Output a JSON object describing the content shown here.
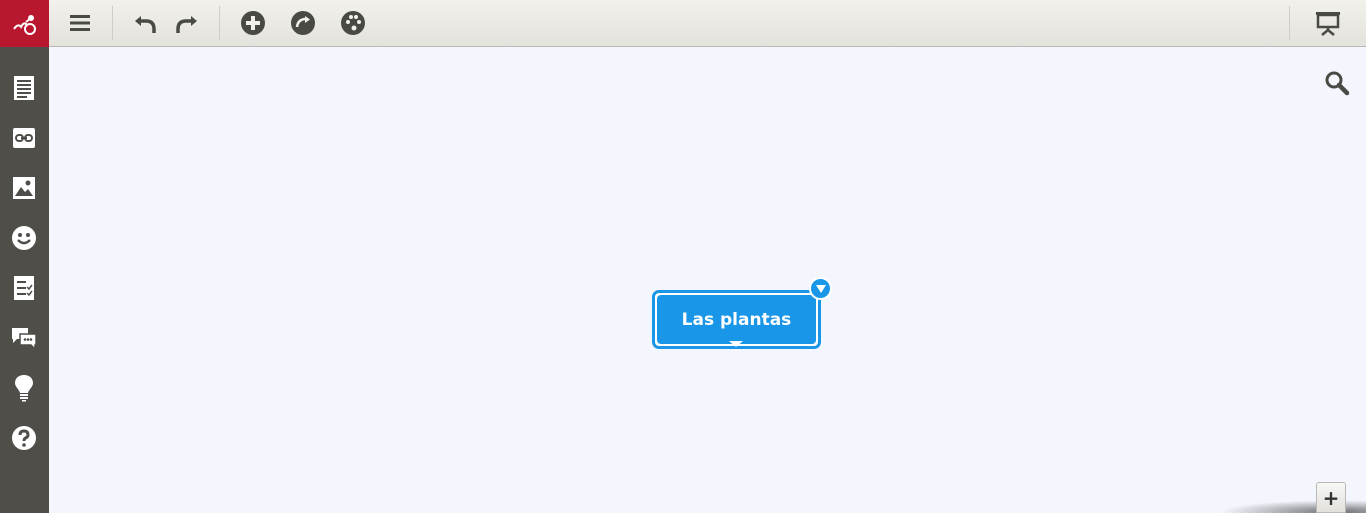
{
  "node": {
    "label": "Las plantas"
  },
  "zoom": {
    "plus_label": "+"
  },
  "colors": {
    "logo_bg": "#b8172e",
    "toolbar_bg": "#e9e8e3",
    "sidebar_bg": "#4f4e49",
    "canvas_bg": "#f3f6fd",
    "node_accent": "#1a96e8",
    "icon_dark": "#4a4a45",
    "icon_light": "#ffffff"
  },
  "toolbar": {
    "icons": [
      "menu-icon",
      "undo-icon",
      "redo-icon",
      "add-icon",
      "connect-icon",
      "palette-icon",
      "presentation-icon"
    ]
  },
  "sidebar": {
    "icons": [
      "text-icon",
      "link-icon",
      "image-icon",
      "emoji-icon",
      "checklist-icon",
      "comments-icon",
      "idea-icon",
      "help-icon"
    ]
  }
}
